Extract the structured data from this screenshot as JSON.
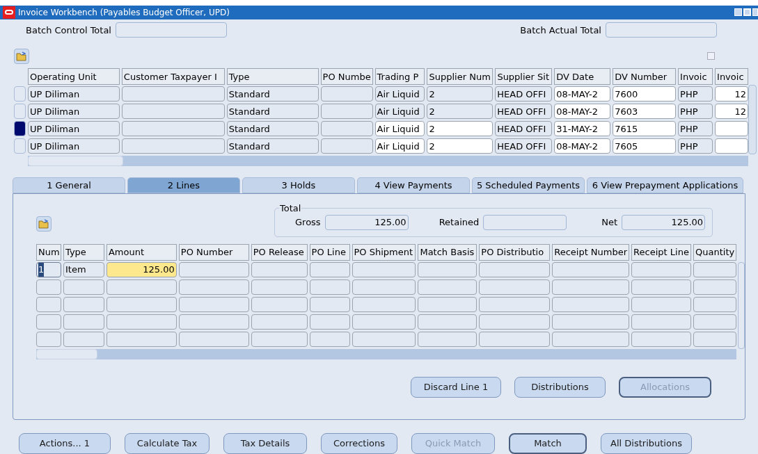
{
  "window": {
    "title": "Invoice Workbench (Payables Budget Officer, UPD)"
  },
  "batch_control_total": {
    "label": "Batch Control Total"
  },
  "batch_actual_total": {
    "label": "Batch Actual Total"
  },
  "checkbox": {
    "checked": false
  },
  "invoices": {
    "columns": [
      "Operating Unit",
      "Customer Taxpayer I",
      "Type",
      "PO Numbe",
      "Trading P",
      "Supplier Num",
      "Supplier Sit",
      "DV Date",
      "DV Number",
      "Invoic",
      "Invoic"
    ],
    "rows": [
      {
        "selected": false,
        "cells": [
          {
            "text": "UP Diliman",
            "editable": false
          },
          {
            "text": "",
            "editable": false
          },
          {
            "text": "Standard",
            "editable": false
          },
          {
            "text": "",
            "editable": false
          },
          {
            "text": "Air Liquid",
            "editable": false
          },
          {
            "text": "2",
            "editable": false
          },
          {
            "text": "HEAD OFFI",
            "editable": false
          },
          {
            "text": "08-MAY-2",
            "editable": true
          },
          {
            "text": "7600",
            "editable": true
          },
          {
            "text": "PHP",
            "editable": false
          },
          {
            "text": "12",
            "editable": true
          }
        ]
      },
      {
        "selected": false,
        "cells": [
          {
            "text": "UP Diliman",
            "editable": false
          },
          {
            "text": "",
            "editable": false
          },
          {
            "text": "Standard",
            "editable": false
          },
          {
            "text": "",
            "editable": false
          },
          {
            "text": "Air Liquid",
            "editable": false
          },
          {
            "text": "2",
            "editable": false
          },
          {
            "text": "HEAD OFFI",
            "editable": false
          },
          {
            "text": "08-MAY-2",
            "editable": true
          },
          {
            "text": "7603",
            "editable": true
          },
          {
            "text": "PHP",
            "editable": false
          },
          {
            "text": "12",
            "editable": true
          }
        ]
      },
      {
        "selected": true,
        "cells": [
          {
            "text": "UP Diliman",
            "editable": false
          },
          {
            "text": "",
            "editable": false
          },
          {
            "text": "Standard",
            "editable": false
          },
          {
            "text": "",
            "editable": false
          },
          {
            "text": "Air Liquid",
            "editable": true
          },
          {
            "text": "2",
            "editable": true
          },
          {
            "text": "HEAD OFFI",
            "editable": false
          },
          {
            "text": "31-MAY-2",
            "editable": true
          },
          {
            "text": "7615",
            "editable": true
          },
          {
            "text": "PHP",
            "editable": false
          },
          {
            "text": "",
            "editable": true
          }
        ]
      },
      {
        "selected": false,
        "cells": [
          {
            "text": "UP Diliman",
            "editable": false
          },
          {
            "text": "",
            "editable": false
          },
          {
            "text": "Standard",
            "editable": false
          },
          {
            "text": "",
            "editable": false
          },
          {
            "text": "Air Liquid",
            "editable": true
          },
          {
            "text": "2",
            "editable": true
          },
          {
            "text": "HEAD OFFI",
            "editable": false
          },
          {
            "text": "08-MAY-2",
            "editable": true
          },
          {
            "text": "7605",
            "editable": true
          },
          {
            "text": "PHP",
            "editable": false
          },
          {
            "text": "",
            "editable": true
          }
        ]
      }
    ]
  },
  "tabs": [
    {
      "label": "1 General",
      "selected": false
    },
    {
      "label": "2 Lines",
      "selected": true
    },
    {
      "label": "3 Holds",
      "selected": false
    },
    {
      "label": "4 View Payments",
      "selected": false
    },
    {
      "label": "5 Scheduled Payments",
      "selected": false
    },
    {
      "label": "6 View Prepayment Applications",
      "selected": false
    }
  ],
  "total": {
    "title": "Total",
    "gross_label": "Gross",
    "gross": "125.00",
    "retained_label": "Retained",
    "net_label": "Net",
    "net": "125.00"
  },
  "lines": {
    "columns": [
      "Num",
      "Type",
      "Amount",
      "PO Number",
      "PO Release",
      "PO Line",
      "PO Shipment",
      "Match Basis",
      "PO Distributio",
      "Receipt Number",
      "Receipt Line",
      "Quantity"
    ],
    "rows": [
      {
        "selected": true,
        "cells": [
          "1",
          "Item",
          "125.00",
          "",
          "",
          "",
          "",
          "",
          "",
          "",
          "",
          ""
        ]
      },
      {
        "selected": false,
        "cells": [
          "",
          "",
          "",
          "",
          "",
          "",
          "",
          "",
          "",
          "",
          "",
          ""
        ]
      },
      {
        "selected": false,
        "cells": [
          "",
          "",
          "",
          "",
          "",
          "",
          "",
          "",
          "",
          "",
          "",
          ""
        ]
      },
      {
        "selected": false,
        "cells": [
          "",
          "",
          "",
          "",
          "",
          "",
          "",
          "",
          "",
          "",
          "",
          ""
        ]
      },
      {
        "selected": false,
        "cells": [
          "",
          "",
          "",
          "",
          "",
          "",
          "",
          "",
          "",
          "",
          "",
          ""
        ]
      }
    ]
  },
  "line_buttons": [
    {
      "label": "Discard Line 1",
      "disabled": false,
      "default": false
    },
    {
      "label": "Distributions",
      "disabled": false,
      "default": false
    },
    {
      "label": "Allocations",
      "disabled": true,
      "default": true
    }
  ],
  "buttons": [
    {
      "label": "Actions... 1",
      "disabled": false,
      "default": false
    },
    {
      "label": "Calculate Tax",
      "disabled": false,
      "default": false
    },
    {
      "label": "Tax Details",
      "disabled": false,
      "default": false
    },
    {
      "label": "Corrections",
      "disabled": false,
      "default": false
    },
    {
      "label": "Quick Match",
      "disabled": true,
      "default": false
    },
    {
      "label": "Match",
      "disabled": false,
      "default": true
    },
    {
      "label": "All Distributions",
      "disabled": false,
      "default": false
    }
  ]
}
